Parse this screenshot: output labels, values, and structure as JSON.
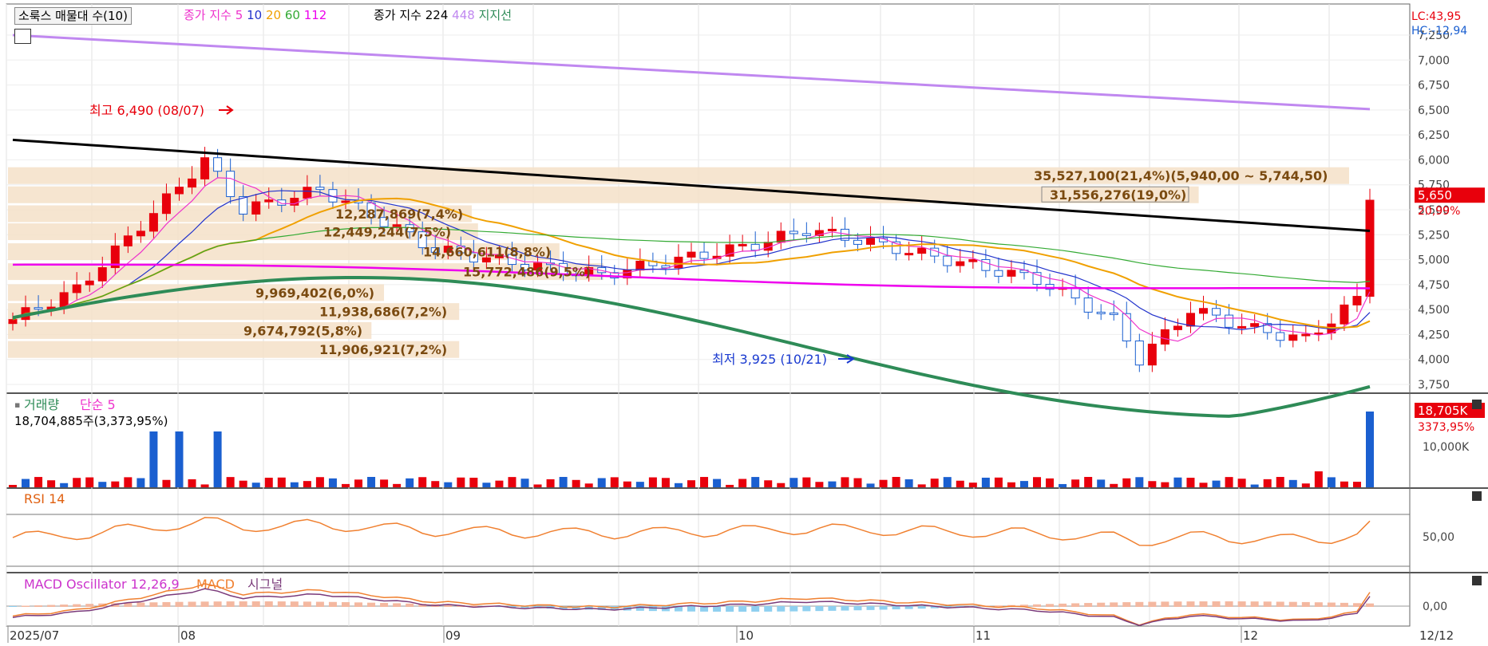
{
  "legend": {
    "btn": "소룩스 매물대 수(10)",
    "ma_label": "종가 지수",
    "ma5": "5",
    "ma10": "10",
    "ma20": "20",
    "ma60": "60",
    "ma112": "112",
    "ma2_label": "종가 지수",
    "ma224": "224",
    "ma448": "448",
    "support": "지지선"
  },
  "colors": {
    "up": "#e8000c",
    "down": "#1a5fd0",
    "ma5": "#ee33cc",
    "ma10": "#2233cc",
    "ma20": "#f0a000",
    "ma60": "#33aa33",
    "ma112": "#ee00ee",
    "ma224": "#000000",
    "ma448": "#c088f0",
    "support": "#2e8b57",
    "volband": "#f5e1c8"
  },
  "price_axis": {
    "lc": "LC:43,95",
    "hc": "HC:-12,94",
    "ticks": [
      "7,250",
      "7,000",
      "6,750",
      "6,500",
      "6,250",
      "6,000",
      "5,750",
      "5,500",
      "5,250",
      "5,000",
      "4,750",
      "4,500",
      "4,250",
      "4,000",
      "3,750"
    ],
    "current": "5,650",
    "change": "20,99%"
  },
  "annotations": {
    "high": "최고 6,490 (08/07)",
    "low": "최저 3,925 (10/21)"
  },
  "volume_profile": [
    {
      "label": "35,527,100(21,4%)(5,940,00 ~ 5,744,50)",
      "price": 5842,
      "pct": 21.4
    },
    {
      "label": "31,556,276(19,0%)",
      "price": 5650,
      "pct": 19.0
    },
    {
      "label": "12,287,869(7,4%)",
      "price": 5460,
      "pct": 7.4
    },
    {
      "label": "12,449,244(7,5%)",
      "price": 5280,
      "pct": 7.5
    },
    {
      "label": "14,660,611(8,8%)",
      "price": 5080,
      "pct": 8.8
    },
    {
      "label": "15,772,486(9,5%)",
      "price": 4880,
      "pct": 9.5
    },
    {
      "label": "9,969,402(6,0%)",
      "price": 4670,
      "pct": 6.0
    },
    {
      "label": "11,938,686(7,2%)",
      "price": 4480,
      "pct": 7.2
    },
    {
      "label": "9,674,792(5,8%)",
      "price": 4290,
      "pct": 5.8
    },
    {
      "label": "11,906,921(7,2%)",
      "price": 4100,
      "pct": 7.2
    }
  ],
  "volume_panel": {
    "title": "거래량",
    "ma": "단순 5",
    "value": "18,704,885주(3,373,95%)",
    "badge": "18,705K",
    "pct": "3373,95%",
    "tick": "10,000K"
  },
  "rsi_panel": {
    "title": "RSI 14",
    "tick": "50,00"
  },
  "macd_panel": {
    "title": "MACD Oscillator 12,26,9",
    "macd": "MACD",
    "signal": "시그널",
    "tick": "0,00"
  },
  "x_axis": {
    "labels": [
      "2025/07",
      "08",
      "09",
      "10",
      "11",
      "12"
    ],
    "date": "12/12"
  },
  "chart_data": {
    "type": "candlestick",
    "price_range": [
      3750,
      7250
    ],
    "high": 6490,
    "low": 3925,
    "last": 5650
  }
}
